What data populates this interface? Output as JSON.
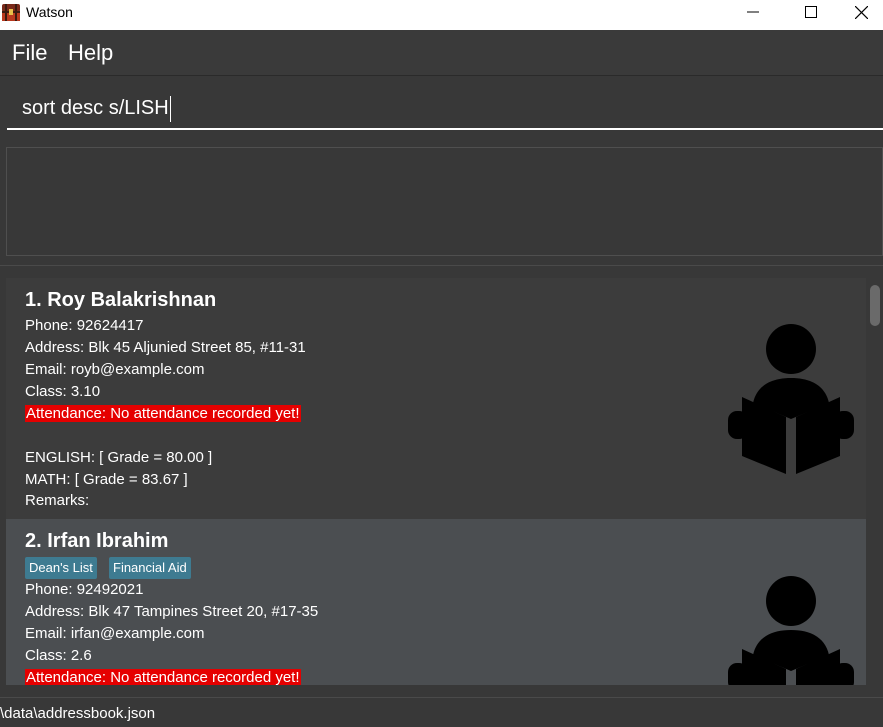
{
  "window": {
    "title": "Watson",
    "icon": "treasure-chest-icon"
  },
  "menu": {
    "file_label": "File",
    "help_label": "Help"
  },
  "command": {
    "value": "sort desc s/LISH"
  },
  "result": {
    "text": ""
  },
  "persons": [
    {
      "name": "1. Roy Balakrishnan",
      "tags": [],
      "phone": "Phone: 92624417",
      "address": "Address: Blk 45 Aljunied Street 85, #11-31",
      "email": "Email: royb@example.com",
      "class": "Class: 3.10",
      "attendance": "Attendance: No attendance recorded yet!",
      "grades": [
        "ENGLISH: [ Grade = 80.00 ]",
        "MATH: [ Grade = 83.67 ]"
      ],
      "remarks": "Remarks:"
    },
    {
      "name": "2. Irfan Ibrahim",
      "tags": [
        "Dean's List",
        "Financial Aid"
      ],
      "phone": "Phone: 92492021",
      "address": "Address: Blk 47 Tampines Street 20, #17-35",
      "email": "Email: irfan@example.com",
      "class": "Class: 2.6",
      "attendance": "Attendance: No attendance recorded yet!"
    }
  ],
  "status": {
    "path": "\\data\\addressbook.json"
  },
  "colors": {
    "background": "#383838",
    "card_primary": "#3c3c3c",
    "card_alternate": "#4b4e51",
    "attendance_alert": "#e50000",
    "tag": "#3e7b91"
  },
  "icons": {
    "minimize": "minimize-icon",
    "maximize": "maximize-icon",
    "close": "close-icon",
    "student": "student-reading-icon"
  }
}
